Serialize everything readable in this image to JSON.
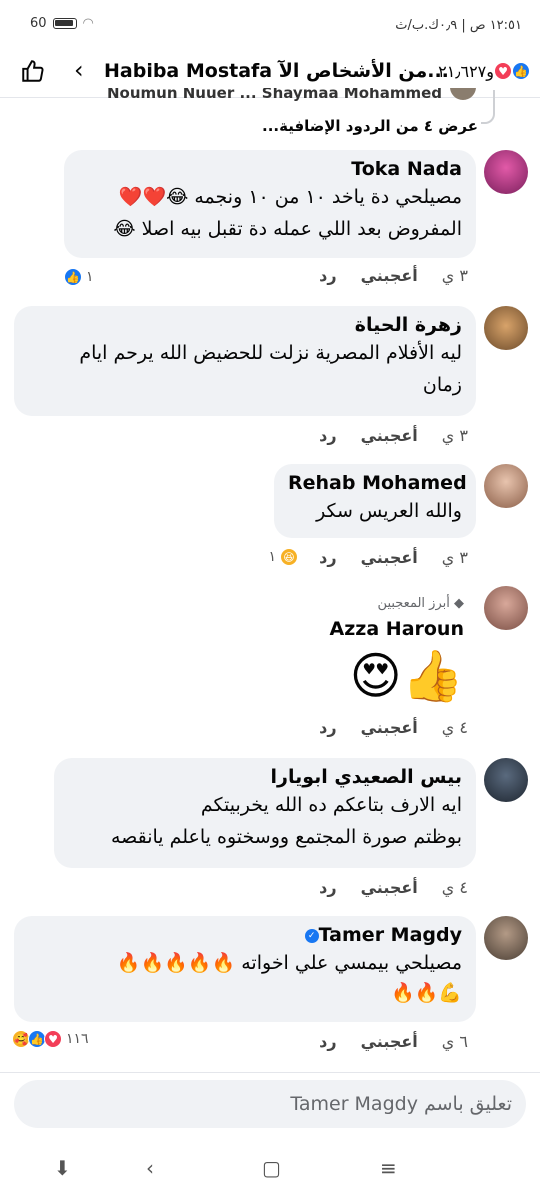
{
  "status_bar": {
    "time_text": "١٢:٥١ ص | ٠٫٩ك.ب/ث",
    "battery_text": "60"
  },
  "header": {
    "title": "Habiba Mostafa من الأشخاص الآ... ",
    "reaction_count": "و٢١٫٦٢٧",
    "back_icon": "chevron-left-icon",
    "like_icon": "thumbs-up-icon"
  },
  "thread": {
    "cut_text": "Noumun Nuuer ... Shaymaa Mohammed",
    "more_replies": "عرض ٤ من الردود الإضافية..."
  },
  "comments": [
    {
      "author": "Toka Nada",
      "lines": [
        "مصيلحي دة ياخد ١٠ من ١٠ ونجمه 😂❤️❤️",
        "المفروض بعد اللي عمله دة تقبل بيه اصلا 😂"
      ],
      "time": "٣ ي",
      "like": "أعجبني",
      "reply": "رد",
      "reactions": "١",
      "avatar_color": "#b0328a"
    },
    {
      "author": "زهرة الحياة",
      "lines": [
        "ليه الأفلام المصرية نزلت للحضيض الله يرحم ايام",
        "زمان"
      ],
      "time": "٣ ي",
      "like": "أعجبني",
      "reply": "رد",
      "avatar_color": "#a57a4c"
    },
    {
      "author": "Rehab Mohamed",
      "lines": [
        "والله العريس سكر"
      ],
      "time": "٣ ي",
      "like": "أعجبني",
      "reply": "رد",
      "reactions": "١",
      "avatar_color": "#c79b7f"
    },
    {
      "badge": "أبرز المعجبين",
      "author": "Azza Haroun",
      "emoji": "😍👍",
      "time": "٤ ي",
      "like": "أعجبني",
      "reply": "رد",
      "avatar_color": "#b07a6a"
    },
    {
      "author": "بيس الصعيدي ابويارا",
      "lines": [
        "ايه الارف بتاعكم ده الله يخربيتكم",
        "بوظتم صورة المجتمع ووسختوه ياعلم يانقصه"
      ],
      "time": "٤ ي",
      "like": "أعجبني",
      "reply": "رد",
      "avatar_color": "#3c4a5c"
    },
    {
      "author": "Tamer Magdy",
      "lines": [
        "مصيلحي بيمسي علي اخواته 🔥🔥🔥🔥🔥",
        "💪🔥🔥"
      ],
      "time": "٦ ي",
      "like": "أعجبني",
      "reply": "رد",
      "reactions": "١١٦",
      "avatar_color": "#6d6258"
    }
  ],
  "input": {
    "placeholder": "تعليق باسم Tamer Magdy"
  }
}
